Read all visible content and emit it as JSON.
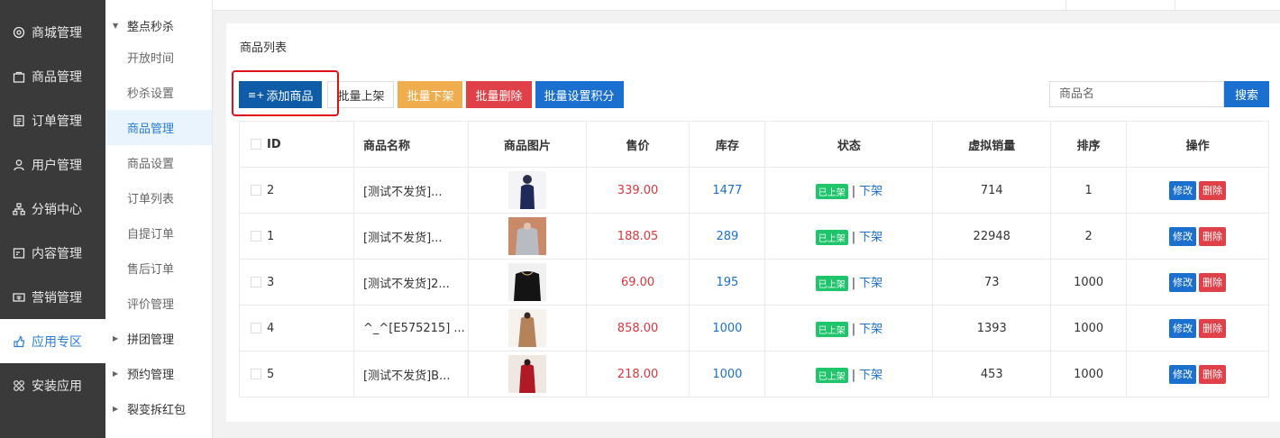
{
  "nav": [
    {
      "label": "商城管理",
      "icon": "settings-icon"
    },
    {
      "label": "商品管理",
      "icon": "bag-icon"
    },
    {
      "label": "订单管理",
      "icon": "document-icon"
    },
    {
      "label": "用户管理",
      "icon": "user-icon"
    },
    {
      "label": "分销中心",
      "icon": "network-icon"
    },
    {
      "label": "内容管理",
      "icon": "content-icon"
    },
    {
      "label": "营销管理",
      "icon": "ticket-icon"
    },
    {
      "label": "应用专区",
      "icon": "hand-icon"
    },
    {
      "label": "安装应用",
      "icon": "grid-icon"
    }
  ],
  "sub_menu": {
    "group_open": "整点秒杀",
    "items": [
      "开放时间",
      "秒杀设置",
      "商品管理",
      "商品设置",
      "订单列表",
      "自提订单",
      "售后订单",
      "评价管理"
    ],
    "groups": [
      "拼团管理",
      "预约管理",
      "裂变拆红包"
    ]
  },
  "card_title": "商品列表",
  "toolbar": {
    "add": "添加商品",
    "batch_on": "批量上架",
    "batch_off": "批量下架",
    "batch_delete": "批量删除",
    "batch_points": "批量设置积分"
  },
  "search": {
    "placeholder": "商品名",
    "button": "搜索"
  },
  "table": {
    "headers": [
      "ID",
      "商品名称",
      "商品图片",
      "售价",
      "库存",
      "状态",
      "虚拟销量",
      "排序",
      "操作"
    ],
    "rows": [
      {
        "id": "2",
        "name": "[测试不发货]...",
        "price": "339.00",
        "stock": "1477",
        "status": "已上架",
        "action": "下架",
        "virtual_sales": "714",
        "sort": "1",
        "edit": "修改",
        "delete": "删除"
      },
      {
        "id": "1",
        "name": "[测试不发货]...",
        "price": "188.05",
        "stock": "289",
        "status": "已上架",
        "action": "下架",
        "virtual_sales": "22948",
        "sort": "2",
        "edit": "修改",
        "delete": "删除"
      },
      {
        "id": "3",
        "name": "[测试不发货]2...",
        "price": "69.00",
        "stock": "195",
        "status": "已上架",
        "action": "下架",
        "virtual_sales": "73",
        "sort": "1000",
        "edit": "修改",
        "delete": "删除"
      },
      {
        "id": "4",
        "name": "^_^[E575215] ...",
        "price": "858.00",
        "stock": "1000",
        "status": "已上架",
        "action": "下架",
        "virtual_sales": "1393",
        "sort": "1000",
        "edit": "修改",
        "delete": "删除"
      },
      {
        "id": "5",
        "name": "[测试不发货]B...",
        "price": "218.00",
        "stock": "1000",
        "status": "已上架",
        "action": "下架",
        "virtual_sales": "453",
        "sort": "1000",
        "edit": "修改",
        "delete": "删除"
      }
    ]
  },
  "colors": {
    "primary": "#0e5ca8",
    "info": "#1a6fcf",
    "warning": "#f0ad4e",
    "danger": "#e04047",
    "success": "#1ec56b",
    "highlight": "#e0101a"
  }
}
